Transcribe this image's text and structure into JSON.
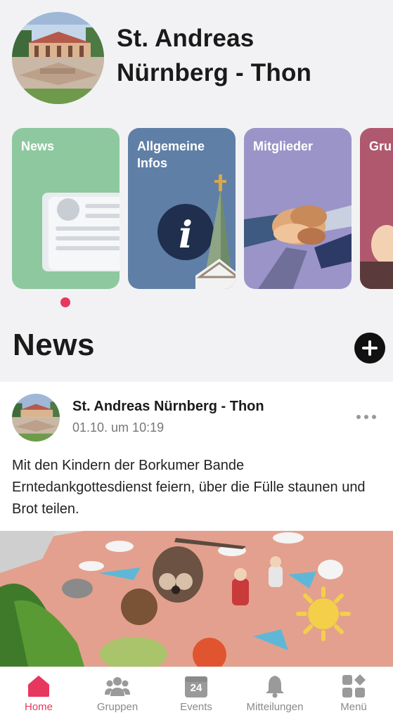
{
  "header": {
    "title_line1": "St. Andreas",
    "title_line2": "Nürnberg - Thon"
  },
  "cards": [
    {
      "label": "News",
      "color": "#8ec89f"
    },
    {
      "label_line1": "Allgemeine",
      "label_line2": "Infos",
      "color": "#5f7fa6"
    },
    {
      "label": "Mitglieder",
      "color": "#9b94c8"
    },
    {
      "label": "Gru",
      "color": "#b0586e"
    }
  ],
  "news_section": {
    "heading": "News",
    "add_icon": "plus-icon"
  },
  "post": {
    "author": "St. Andreas Nürnberg - Thon",
    "time": "01.10. um 10:19",
    "text": "Mit den Kindern der Borkumer Bande Erntedankgottesdienst feiern, über die Fülle staunen und Brot teilen.",
    "more_icon": "more-icon"
  },
  "tabbar": {
    "tabs": [
      {
        "label": "Home",
        "icon": "home-icon",
        "active": true
      },
      {
        "label": "Gruppen",
        "icon": "groups-icon"
      },
      {
        "label": "Events",
        "icon": "calendar-icon",
        "badge": "24"
      },
      {
        "label": "Mitteilungen",
        "icon": "bell-icon"
      },
      {
        "label": "Menü",
        "icon": "menu-grid-icon"
      }
    ]
  },
  "colors": {
    "accent": "#e8375f",
    "background": "#f2f2f4"
  }
}
